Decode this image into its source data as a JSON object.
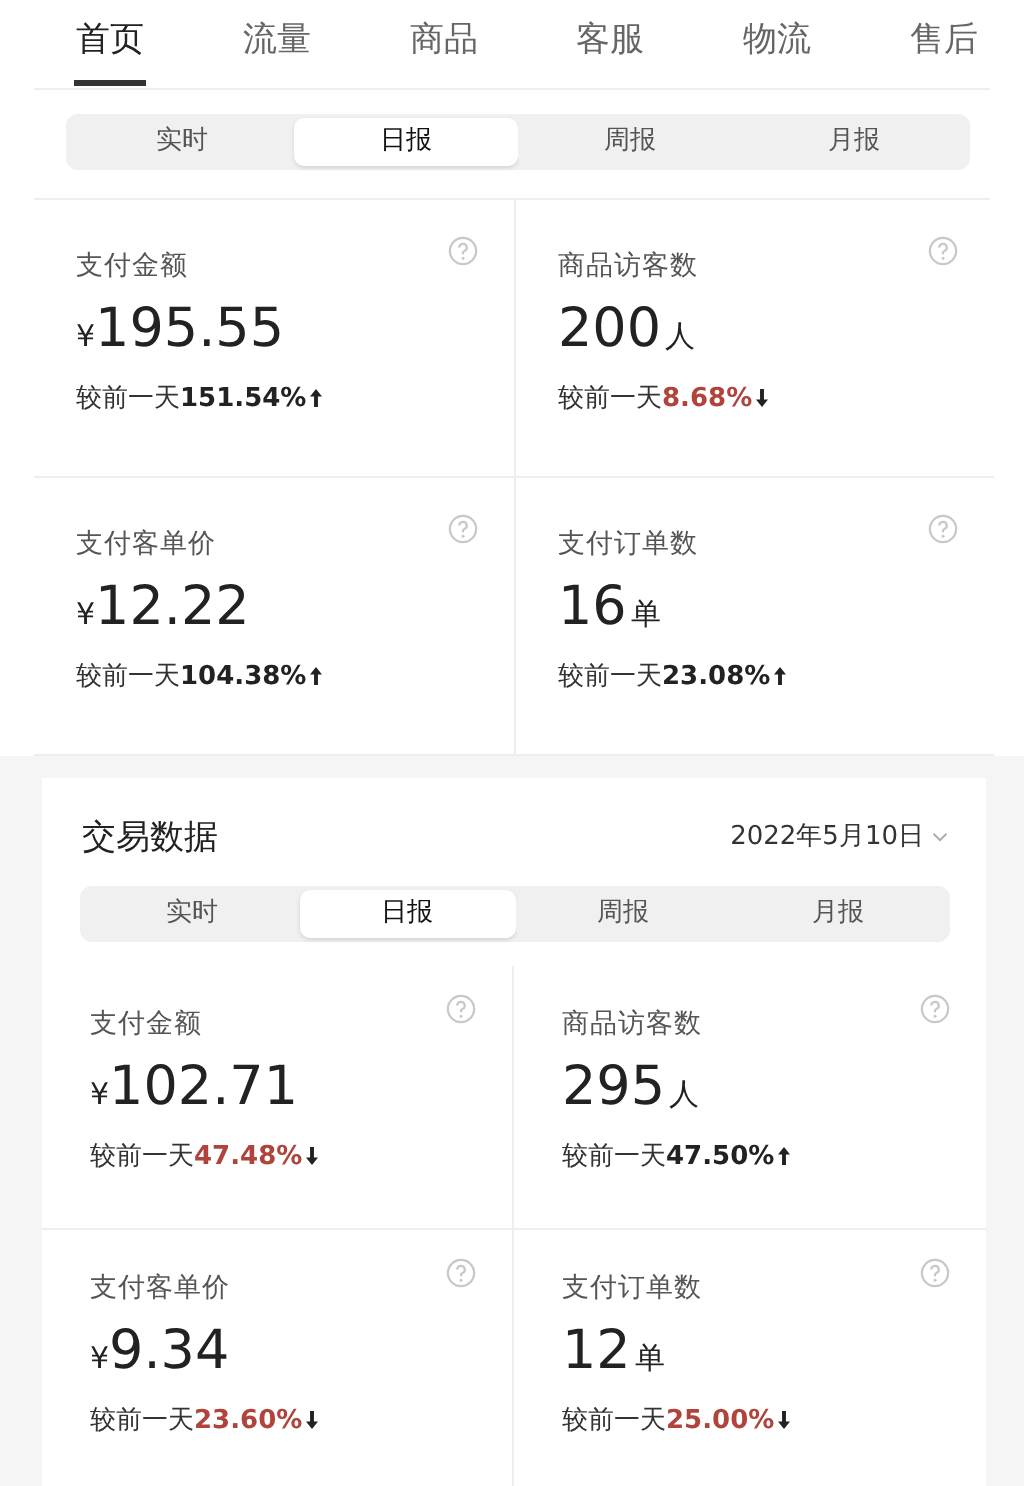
{
  "top_tabs": [
    {
      "label": "首页",
      "selected": true
    },
    {
      "label": "流量",
      "selected": false
    },
    {
      "label": "商品",
      "selected": false
    },
    {
      "label": "客服",
      "selected": false
    },
    {
      "label": "物流",
      "selected": false
    },
    {
      "label": "售后",
      "selected": false
    }
  ],
  "period_tabs": [
    {
      "label": "实时",
      "selected": false
    },
    {
      "label": "日报",
      "selected": true
    },
    {
      "label": "周报",
      "selected": false
    },
    {
      "label": "月报",
      "selected": false
    }
  ],
  "metrics": [
    {
      "label": "支付金额",
      "currency": "¥",
      "value": "195.55",
      "change_label": "较前一天",
      "change": "151.54%",
      "rising": true
    },
    {
      "label": "商品访客数",
      "value": "200",
      "unit": "人",
      "change_label": "较前一天",
      "change": "8.68%",
      "rising": false
    },
    {
      "label": "支付客单价",
      "currency": "¥",
      "value": "12.22",
      "change_label": "较前一天",
      "change": "104.38%",
      "rising": true
    },
    {
      "label": "支付订单数",
      "value": "16",
      "unit": "单",
      "change_label": "较前一天",
      "change": "23.08%",
      "rising": true
    }
  ],
  "trade_section": {
    "title": "交易数据",
    "date": "2022年5月10日",
    "period_tabs": [
      {
        "label": "实时",
        "selected": false
      },
      {
        "label": "日报",
        "selected": true
      },
      {
        "label": "周报",
        "selected": false
      },
      {
        "label": "月报",
        "selected": false
      }
    ],
    "metrics": [
      {
        "label": "支付金额",
        "currency": "¥",
        "value": "102.71",
        "change_label": "较前一天",
        "change": "47.48%",
        "rising": false
      },
      {
        "label": "商品访客数",
        "value": "295",
        "unit": "人",
        "change_label": "较前一天",
        "change": "47.50%",
        "rising": true
      },
      {
        "label": "支付客单价",
        "currency": "¥",
        "value": "9.34",
        "change_label": "较前一天",
        "change": "23.60%",
        "rising": false
      },
      {
        "label": "支付订单数",
        "value": "12",
        "unit": "单",
        "change_label": "较前一天",
        "change": "25.00%",
        "rising": false
      }
    ]
  }
}
